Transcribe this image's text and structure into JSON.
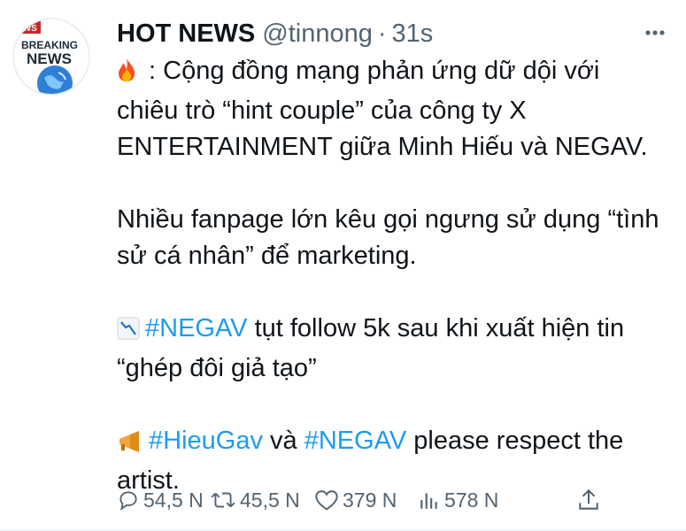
{
  "tweet": {
    "author_name": "HOT NEWS",
    "handle": "@tinnong",
    "separator": "·",
    "time": "31s",
    "more_icon": "ellipsis-icon",
    "avatar": {
      "top_text": "EWS",
      "line1": "BREAKING",
      "line2": "NEWS"
    },
    "body": {
      "p1_rest": " : Cộng đồng mạng phản ứng dữ dội với chiêu trò “hint couple” của công ty X ENTERTAINMENT giữa Minh Hiếu và NEGAV.",
      "p1_icon": "fire-emoji",
      "p2": "Nhiều fanpage lớn kêu gọi ngưng sử dụng “tình sử cá nhân” để marketing.",
      "p3_icon": "chart-decreasing-emoji",
      "p3_hashtag": "#NEGAV",
      "p3_rest": " tụt follow 5k sau khi xuất hiện tin “ghép đôi giả tạo”",
      "p4_icon": "megaphone-emoji",
      "p4_hashtag1": "#HieuGav",
      "p4_mid": " và ",
      "p4_hashtag2": "#NEGAV",
      "p4_rest": " please respect the artist."
    },
    "actions": {
      "replies": "54,5 N",
      "retweets": "45,5 N",
      "likes": "379 N",
      "views": "578 N"
    },
    "colors": {
      "link": "#1d9bf0",
      "muted": "#536471",
      "text": "#0f1419"
    }
  }
}
